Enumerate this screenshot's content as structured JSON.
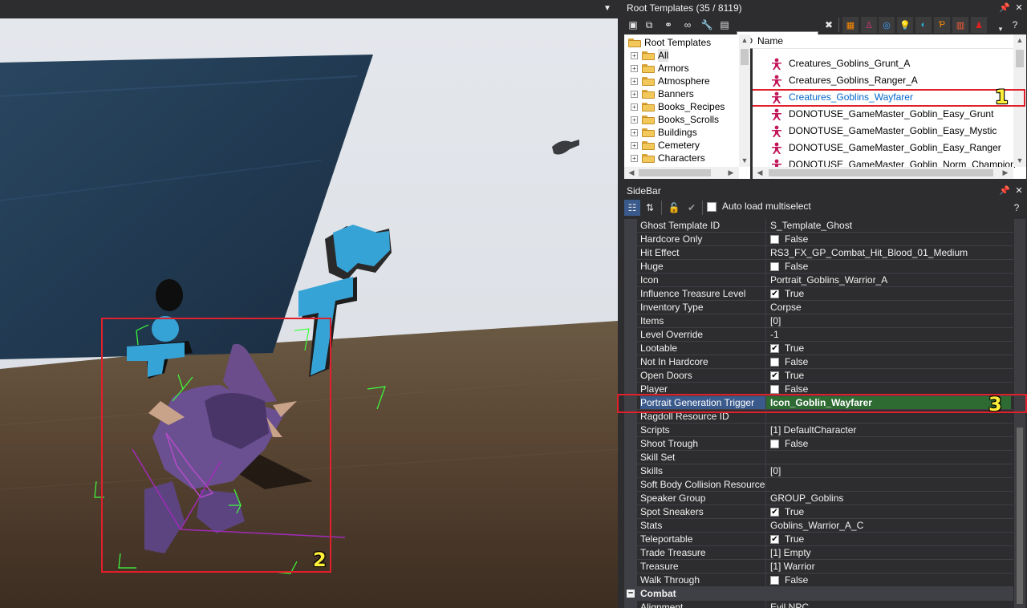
{
  "viewport": {
    "marker_2": "2"
  },
  "root_templates": {
    "title": "Root Templates (35 / 8119)",
    "search_value": "Goblin",
    "tree": {
      "root": "Root Templates",
      "items": [
        "All",
        "Armors",
        "Atmosphere",
        "Banners",
        "Books_Recipes",
        "Books_Scrolls",
        "Buildings",
        "Cemetery",
        "Characters"
      ]
    },
    "list": {
      "header": "Name",
      "rows": [
        "Creatures_Goblins_Grunt_A",
        "Creatures_Goblins_Ranger_A",
        "Creatures_Goblins_Wayfarer",
        "DONOTUSE_GameMaster_Goblin_Easy_Grunt",
        "DONOTUSE_GameMaster_Goblin_Easy_Mystic",
        "DONOTUSE_GameMaster_Goblin_Easy_Ranger",
        "DONOTUSE_GameMaster_Goblin_Norm_Champion"
      ],
      "marker_1": "1"
    },
    "colors": {
      "highlight_text": "#0066cc",
      "char_icon": "#c2185b"
    }
  },
  "sidebar": {
    "title": "SideBar",
    "auto_load_label": "Auto load multiselect",
    "properties": [
      {
        "name": "Ghost Template ID",
        "value": "S_Template_Ghost"
      },
      {
        "name": "Hardcore Only",
        "check": false,
        "value": "False"
      },
      {
        "name": "Hit Effect",
        "value": "RS3_FX_GP_Combat_Hit_Blood_01_Medium"
      },
      {
        "name": "Huge",
        "check": false,
        "value": "False"
      },
      {
        "name": "Icon",
        "value": "Portrait_Goblins_Warrior_A"
      },
      {
        "name": "Influence Treasure Level",
        "check": true,
        "value": "True"
      },
      {
        "name": "Inventory Type",
        "value": "Corpse"
      },
      {
        "name": "Items",
        "value": "[0]"
      },
      {
        "name": "Level Override",
        "value": "-1"
      },
      {
        "name": "Lootable",
        "check": true,
        "value": "True"
      },
      {
        "name": "Not In Hardcore",
        "check": false,
        "value": "False"
      },
      {
        "name": "Open Doors",
        "check": true,
        "value": "True"
      },
      {
        "name": "Player",
        "check": false,
        "value": "False"
      },
      {
        "name": "Portrait Generation Trigger",
        "value": "Icon_Goblin_Wayfarer"
      },
      {
        "name": "Ragdoll Resource ID",
        "value": ""
      },
      {
        "name": "Scripts",
        "value": "[1] DefaultCharacter"
      },
      {
        "name": "Shoot Trough",
        "check": false,
        "value": "False"
      },
      {
        "name": "Skill Set",
        "value": ""
      },
      {
        "name": "Skills",
        "value": "[0]"
      },
      {
        "name": "Soft Body Collision Resource ID",
        "value": ""
      },
      {
        "name": "Speaker Group",
        "value": "GROUP_Goblins"
      },
      {
        "name": "Spot Sneakers",
        "check": true,
        "value": "True"
      },
      {
        "name": "Stats",
        "value": "Goblins_Warrior_A_C"
      },
      {
        "name": "Teleportable",
        "check": true,
        "value": "True"
      },
      {
        "name": "Trade Treasure",
        "value": "[1] Empty"
      },
      {
        "name": "Treasure",
        "value": "[1] Warrior"
      },
      {
        "name": "Walk Through",
        "check": false,
        "value": "False"
      }
    ],
    "category": "Combat",
    "next_row": {
      "name": "Alignment",
      "value": "Evil NPC"
    },
    "marker_3": "3"
  }
}
